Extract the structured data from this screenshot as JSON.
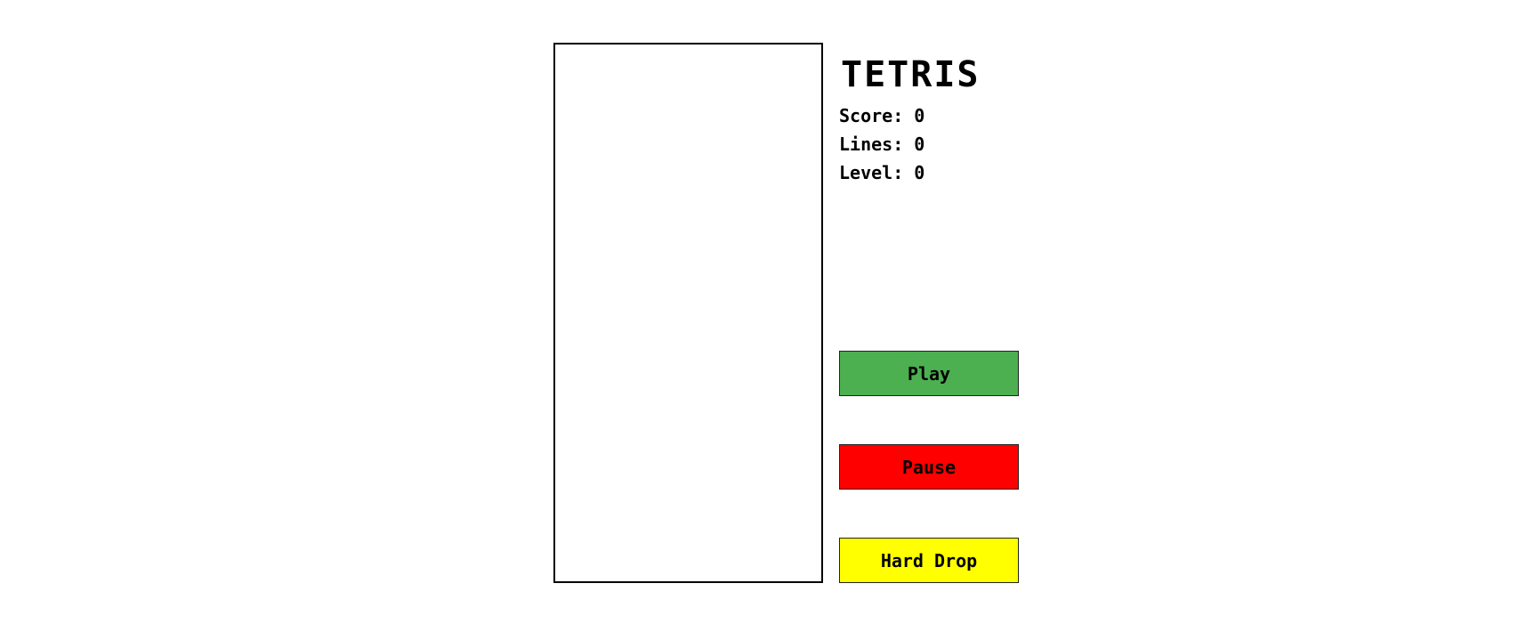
{
  "game": {
    "title": "TETRIS"
  },
  "stats": {
    "score_label": "Score:",
    "score_value": "0",
    "lines_label": "Lines:",
    "lines_value": "0",
    "level_label": "Level:",
    "level_value": "0"
  },
  "buttons": {
    "play_label": "Play",
    "pause_label": "Pause",
    "hard_drop_label": "Hard Drop"
  },
  "colors": {
    "play": "#4caf50",
    "pause": "#ff0000",
    "hard_drop": "#ffff00",
    "board_border": "#000000"
  }
}
